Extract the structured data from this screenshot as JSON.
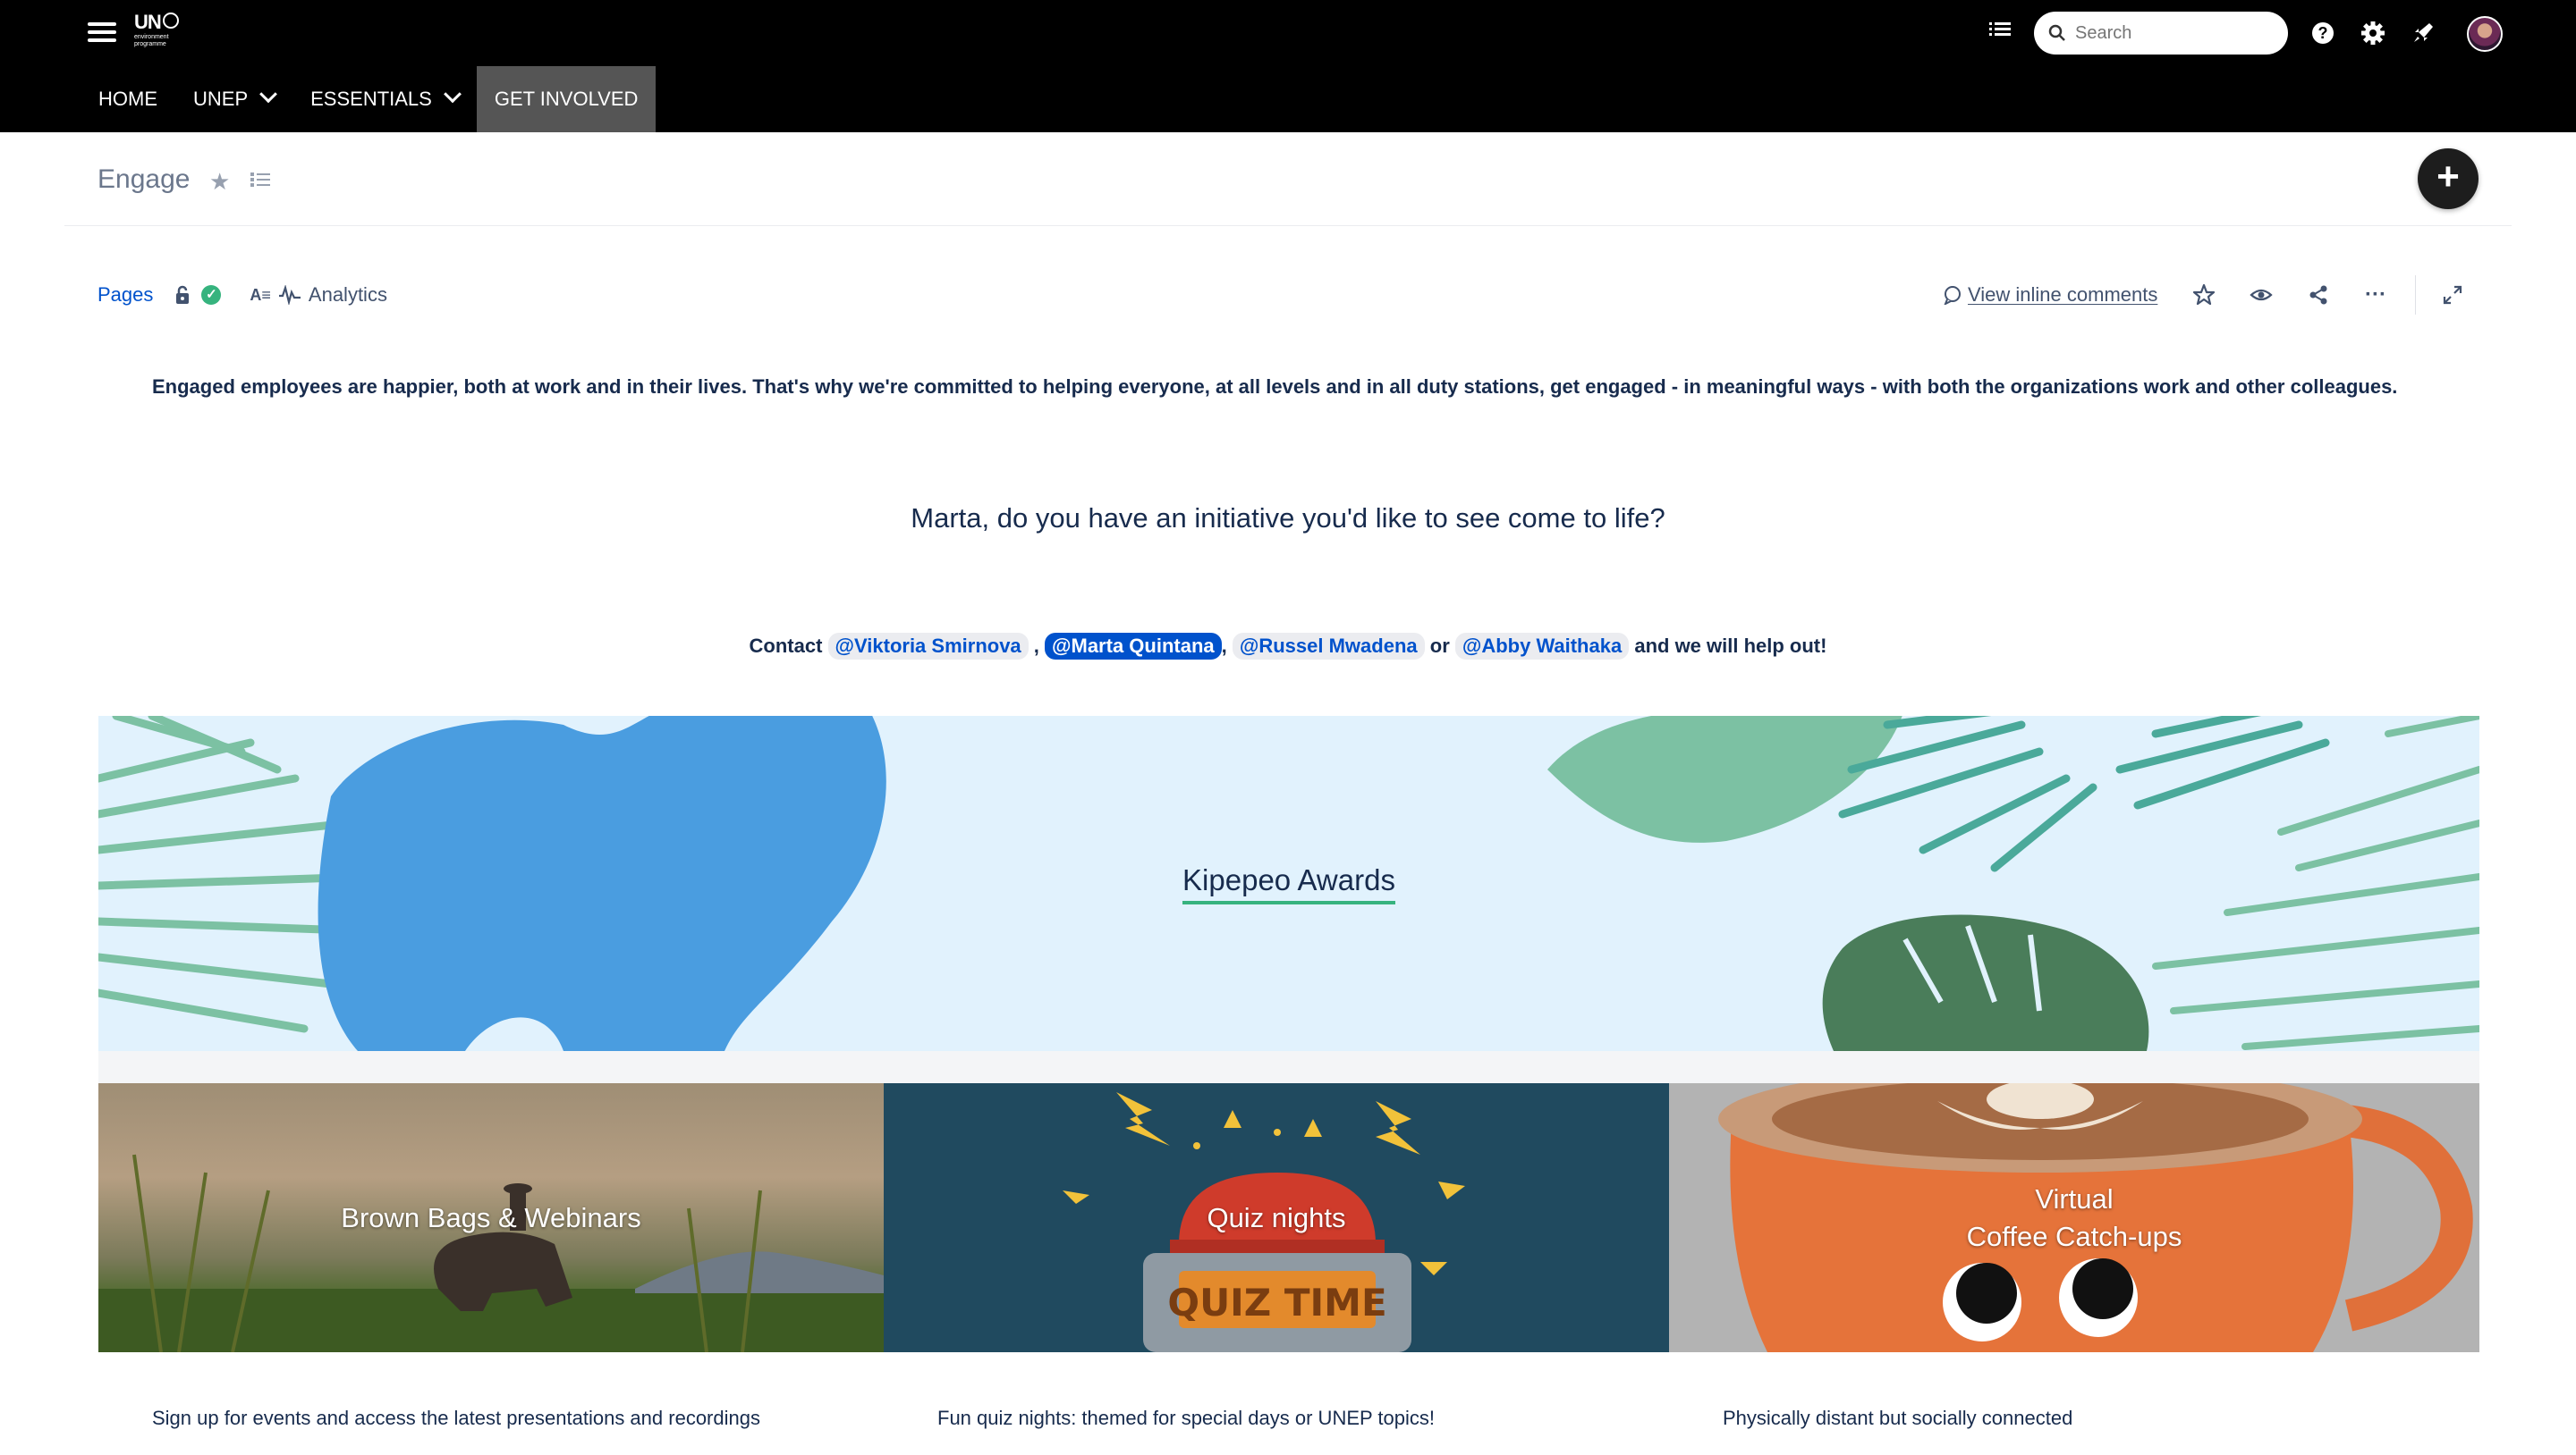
{
  "header": {
    "logo": {
      "line1": "UN",
      "line2": "environment",
      "line3": "programme"
    },
    "search_placeholder": "Search",
    "nav": [
      {
        "label": "HOME"
      },
      {
        "label": "UNEP"
      },
      {
        "label": "ESSENTIALS"
      },
      {
        "label": "GET INVOLVED"
      }
    ]
  },
  "page": {
    "title": "Engage",
    "create_symbol": "+"
  },
  "byline": {
    "pages_label": "Pages",
    "analytics_label": "Analytics",
    "readtime_glyph": "A≡"
  },
  "actions": {
    "inline_comments_label": "View inline comments",
    "more_glyph": "···"
  },
  "content": {
    "intro_bold": "Engaged employees",
    "intro_rest": " are happier, both at work and in their lives. That's why we're committed to helping everyone, at all levels and in all duty stations, get engaged - in meaningful ways - with both the organizations work and other colleagues.",
    "question": "Marta, do you have an initiative you'd like to see come to life?",
    "contact": {
      "prefix": "Contact",
      "mentions": [
        "@Viktoria Smirnova",
        "@Marta Quintana",
        "@Russel Mwadena",
        "@Abby Waithaka"
      ],
      "sep1": ",",
      "sep2": ",",
      "or": "or",
      "suffix": "and we will help out!"
    }
  },
  "banner": {
    "title": "Kipepeo Awards",
    "colors": {
      "background": "#e1f2fd",
      "blue_leaf": "#4a9de0",
      "light_leaf": "#7cc1a3",
      "dark_leaf": "#4a7d5a"
    }
  },
  "cards": [
    {
      "line1": "Brown Bags & Webinars",
      "line2": "",
      "description": "Sign up for events and access the latest presentations and recordings"
    },
    {
      "line1": "Quiz nights",
      "line2": "",
      "quiz_sign": "QUIZ TIME",
      "description": "Fun quiz nights: themed for special days or UNEP topics!"
    },
    {
      "line1": "Virtual",
      "line2": "Coffee Catch-ups",
      "description": "Physically distant but socially connected"
    }
  ]
}
